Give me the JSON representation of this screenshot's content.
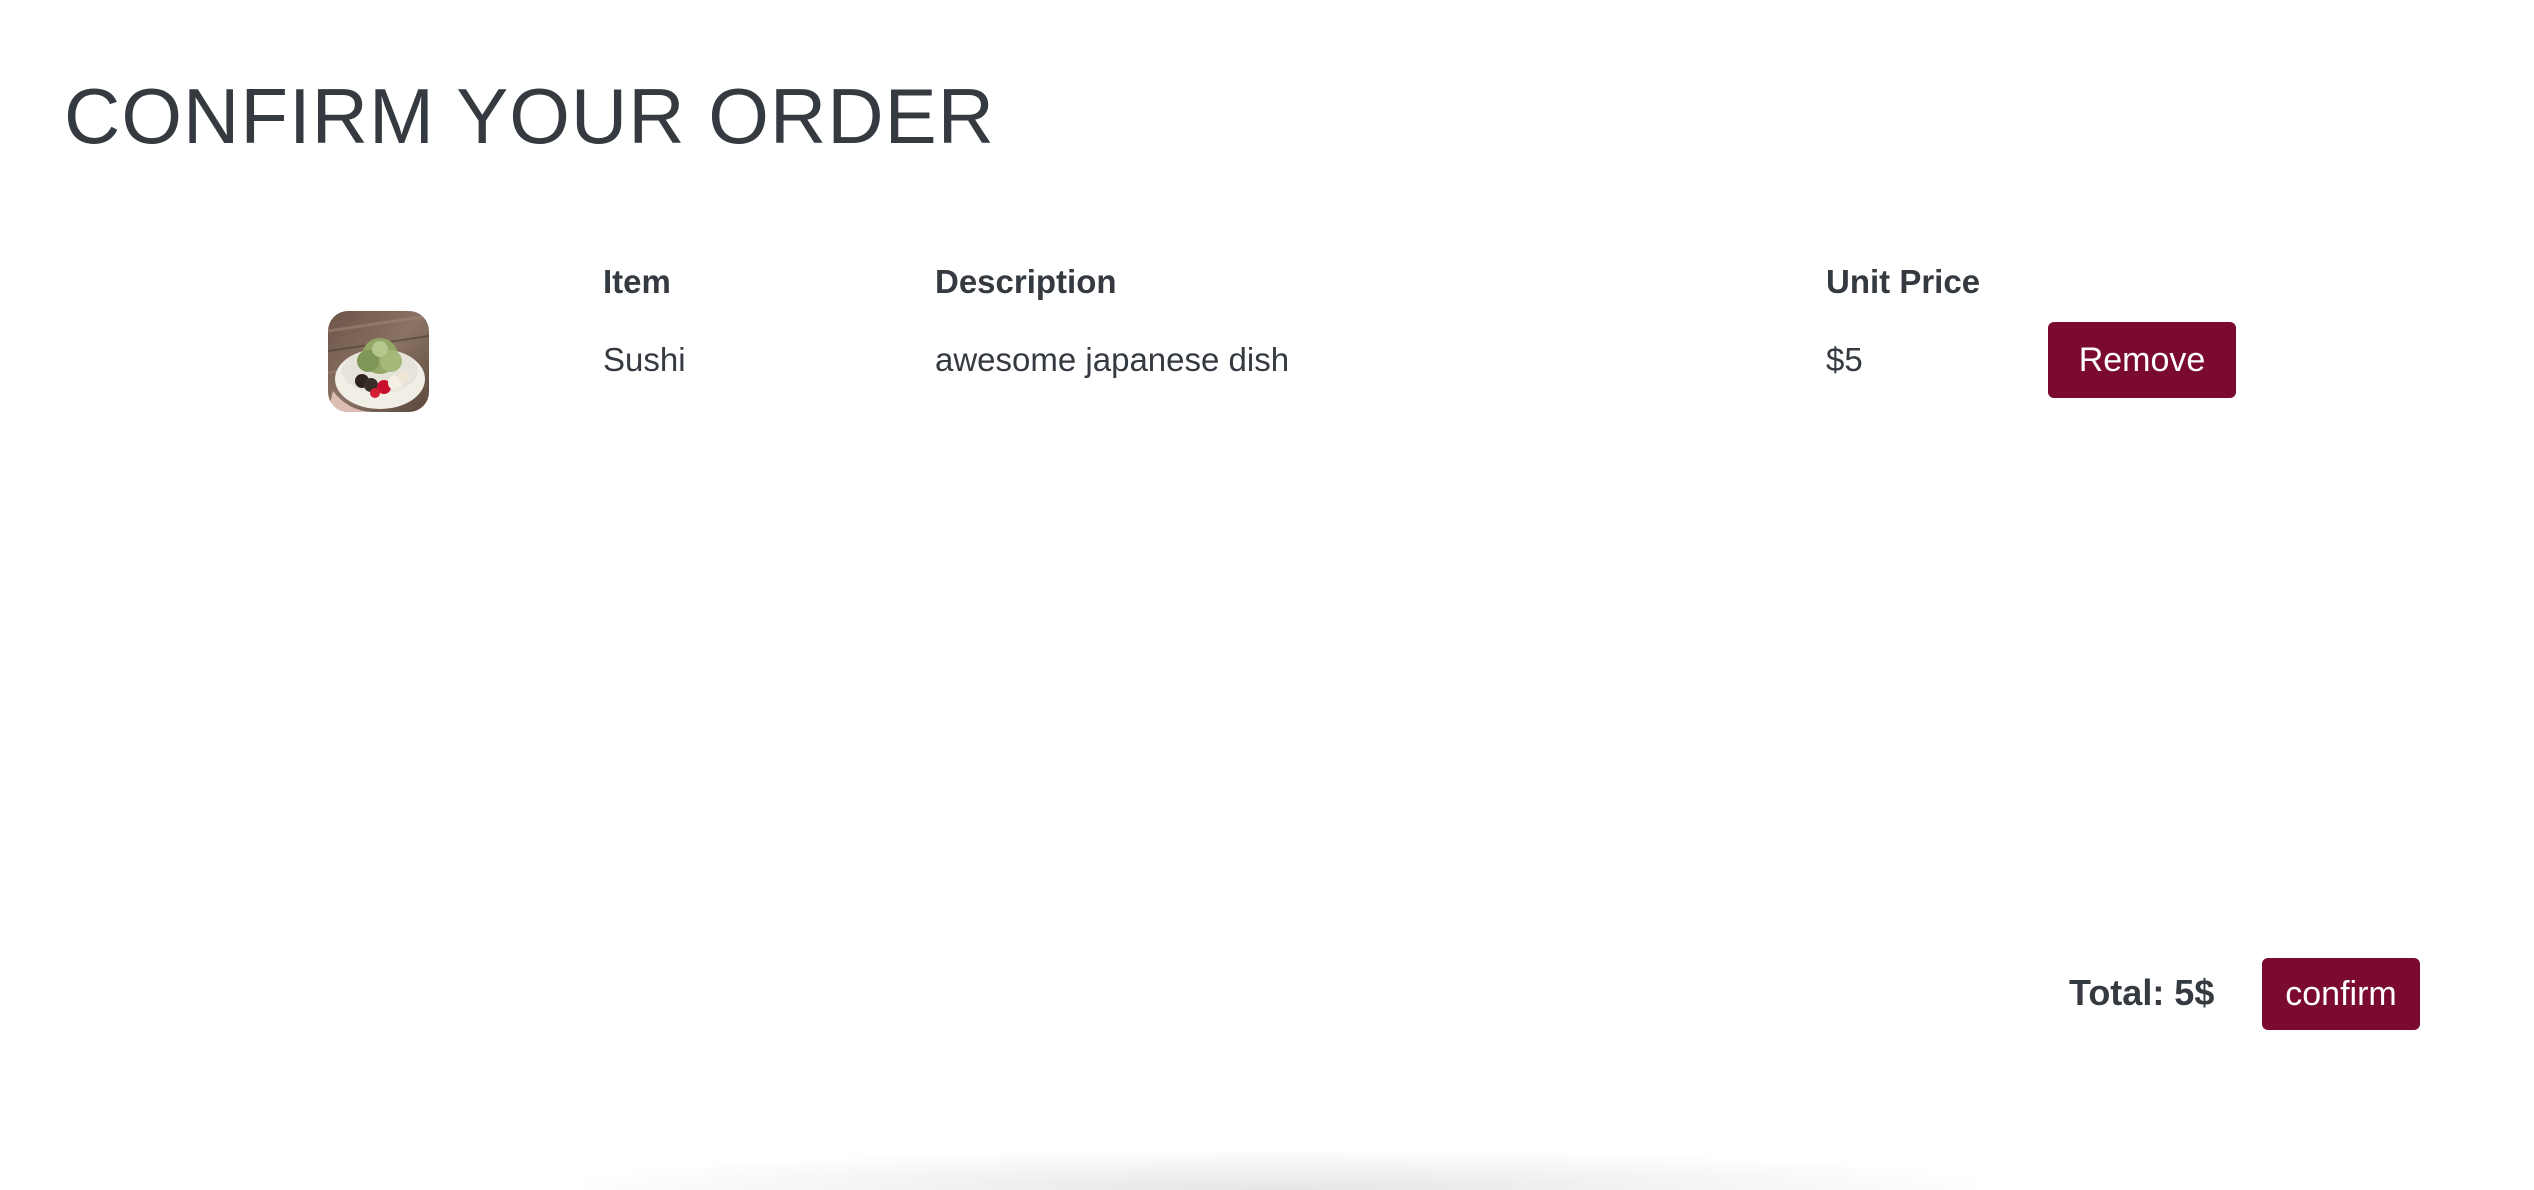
{
  "page": {
    "title": "CONFIRM YOUR ORDER"
  },
  "table": {
    "headers": {
      "item": "Item",
      "description": "Description",
      "unit_price": "Unit Price"
    },
    "rows": [
      {
        "image_icon": "food-bowl-image",
        "item": "Sushi",
        "description": "awesome japanese dish",
        "unit_price": "$5",
        "remove_label": "Remove"
      }
    ]
  },
  "footer": {
    "total_label": "Total: 5$",
    "confirm_label": "confirm"
  },
  "colors": {
    "accent": "#7a0a2e",
    "text": "#343a40",
    "background": "#ffffff"
  }
}
